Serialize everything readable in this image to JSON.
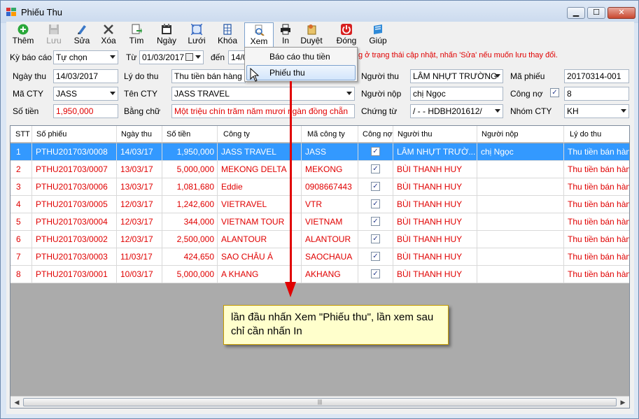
{
  "window": {
    "title": "Phiếu Thu",
    "min": "▁",
    "max": "☐",
    "close": "✕"
  },
  "toolbar": [
    {
      "label": "Thêm",
      "icon": "add-icon",
      "disabled": false
    },
    {
      "label": "Lưu",
      "icon": "save-icon",
      "disabled": true
    },
    {
      "label": "Sửa",
      "icon": "edit-icon",
      "disabled": false
    },
    {
      "label": "Xóa",
      "icon": "delete-icon",
      "disabled": false
    },
    {
      "label": "Tìm",
      "icon": "find-icon",
      "disabled": false
    },
    {
      "label": "Ngày",
      "icon": "calendar-icon",
      "disabled": false
    },
    {
      "label": "Lưới",
      "icon": "grid-icon",
      "disabled": false
    },
    {
      "label": "Khóa",
      "icon": "lock-icon",
      "disabled": false
    },
    {
      "label": "Xem",
      "icon": "preview-icon",
      "disabled": false
    },
    {
      "label": "In",
      "icon": "print-icon",
      "disabled": false
    },
    {
      "label": "Duyệt",
      "icon": "approve-icon",
      "disabled": false
    },
    {
      "label": "Đóng",
      "icon": "power-icon",
      "disabled": false
    },
    {
      "label": "Giúp",
      "icon": "help-icon",
      "disabled": false
    }
  ],
  "filter": {
    "period_label": "Kỳ báo cáo",
    "period_value": "Tự chọn",
    "from_label": "Từ",
    "from_value": "01/03/2017",
    "to_label": "đến",
    "to_value": "14/0",
    "notice": "g ở trạng thái cập nhật, nhấn 'Sửa' nếu muốn lưu thay đổi."
  },
  "form": {
    "ngaythu_label": "Ngày thu",
    "ngaythu_value": "14/03/2017",
    "lydothu_label": "Lý do thu",
    "lydothu_value": "Thu tiền bán hàng",
    "nguoithu_label": "Người thu",
    "nguoithu_value": "LÂM NHỰT TRƯỜNG",
    "maphieu_label": "Mã phiếu",
    "maphieu_value": "20170314-001",
    "macty_label": "Mã CTY",
    "macty_value": "JASS",
    "tencty_label": "Tên CTY",
    "tencty_value": "JASS TRAVEL",
    "nguoinop_label": "Người nộp",
    "nguoinop_value": "chị Ngọc",
    "congno_label": "Công nợ",
    "congno_checked": "✓",
    "congno_value": "8",
    "sotien_label": "Số tiền",
    "sotien_value": "1,950,000",
    "bangchu_label": "Bằng chữ",
    "bangchu_value": "Một triệu chín trăm năm mươi ngàn đồng chẵn",
    "chungtu_label": "Chứng từ",
    "chungtu_value": "/ - -  HDBH201612/",
    "nhomcty_label": "Nhóm CTY",
    "nhomcty_value": "KH"
  },
  "menu": {
    "item1": "Báo cáo thu tiền",
    "item2": "Phiếu thu"
  },
  "grid": {
    "headers": [
      "STT",
      "Số phiếu",
      "Ngày thu",
      "Số tiền",
      "Công ty",
      "Mã công ty",
      "Công nợ",
      "Người thu",
      "Người nộp",
      "Lý do thu"
    ],
    "rows": [
      [
        "1",
        "PTHU201703/0008",
        "14/03/17",
        "1,950,000",
        "JASS TRAVEL",
        "JASS",
        "✓",
        "LÂM NHỰT TRƯỜ...",
        "chị Ngọc",
        "Thu tiền bán hàng"
      ],
      [
        "2",
        "PTHU201703/0007",
        "13/03/17",
        "5,000,000",
        "MEKONG DELTA",
        "MEKONG",
        "✓",
        "BÙI THANH HUY",
        "",
        "Thu tiền bán hàng"
      ],
      [
        "3",
        "PTHU201703/0006",
        "13/03/17",
        "1,081,680",
        "Eddie",
        "0908667443",
        "✓",
        "BÙI THANH HUY",
        "",
        "Thu tiền bán hàng"
      ],
      [
        "4",
        "PTHU201703/0005",
        "12/03/17",
        "1,242,600",
        "VIETRAVEL",
        "VTR",
        "✓",
        "BÙI THANH HUY",
        "",
        "Thu tiền bán hàng"
      ],
      [
        "5",
        "PTHU201703/0004",
        "12/03/17",
        "344,000",
        "VIETNAM TOUR",
        "VIETNAM",
        "✓",
        "BÙI THANH HUY",
        "",
        "Thu tiền bán hàng"
      ],
      [
        "6",
        "PTHU201703/0002",
        "12/03/17",
        "2,500,000",
        "ALANTOUR",
        "ALANTOUR",
        "✓",
        "BÙI THANH HUY",
        "",
        "Thu tiền bán hàng"
      ],
      [
        "7",
        "PTHU201703/0003",
        "11/03/17",
        "424,650",
        "SAO CHÂU Á",
        "SAOCHAUA",
        "✓",
        "BÙI THANH HUY",
        "",
        "Thu tiền bán hàng"
      ],
      [
        "8",
        "PTHU201703/0001",
        "10/03/17",
        "5,000,000",
        "A KHANG",
        "AKHANG",
        "✓",
        "BÙI THANH HUY",
        "",
        "Thu tiền bán hàng"
      ]
    ],
    "scroll_thumb": "|||"
  },
  "callout": {
    "text": "lần đầu nhấn Xem \"Phiếu thu\", lần xem sau chỉ cần nhấn In"
  },
  "colors": {
    "selected_row": "#3399ff",
    "row_text": "#e00000",
    "callout_bg": "#ffffcc"
  }
}
